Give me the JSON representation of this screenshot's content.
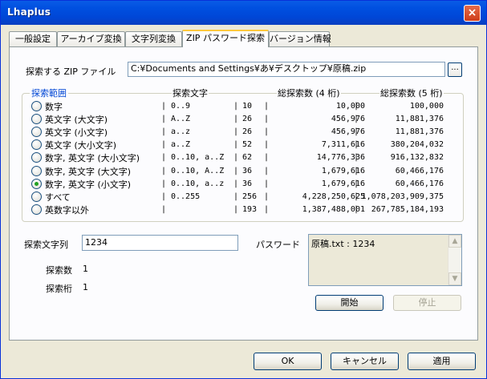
{
  "window": {
    "title": "Lhaplus",
    "close_icon": "×"
  },
  "tabs": [
    {
      "label": "一般設定"
    },
    {
      "label": "アーカイブ変換"
    },
    {
      "label": "文字列変換"
    },
    {
      "label": "ZIP パスワード探索"
    },
    {
      "label": "バージョン情報"
    }
  ],
  "target": {
    "label": "探索する ZIP ファイル",
    "value": "C:¥Documents and Settings¥あ¥デスクトップ¥原稿.zip",
    "browse_label": "..."
  },
  "range": {
    "legend": "探索範囲",
    "headers": {
      "chars": "探索文字",
      "total4": "総探索数 (4 桁)",
      "total5": "総探索数 (5 桁)"
    },
    "options": [
      {
        "label": "数字",
        "chars": "0..9",
        "count": "10",
        "total4": "10,000",
        "total5": "100,000",
        "selected": false
      },
      {
        "label": "英文字 (大文字)",
        "chars": "A..Z",
        "count": "26",
        "total4": "456,976",
        "total5": "11,881,376",
        "selected": false
      },
      {
        "label": "英文字 (小文字)",
        "chars": "a..z",
        "count": "26",
        "total4": "456,976",
        "total5": "11,881,376",
        "selected": false
      },
      {
        "label": "英文字 (大小文字)",
        "chars": "a..Z",
        "count": "52",
        "total4": "7,311,616",
        "total5": "380,204,032",
        "selected": false
      },
      {
        "label": "数字, 英文字 (大小文字)",
        "chars": "0..10, a..Z",
        "count": "62",
        "total4": "14,776,336",
        "total5": "916,132,832",
        "selected": false
      },
      {
        "label": "数字, 英文字 (大文字)",
        "chars": "0..10, A..Z",
        "count": "36",
        "total4": "1,679,616",
        "total5": "60,466,176",
        "selected": false
      },
      {
        "label": "数字, 英文字 (小文字)",
        "chars": "0..10, a..z",
        "count": "36",
        "total4": "1,679,616",
        "total5": "60,466,176",
        "selected": true
      },
      {
        "label": "すべて",
        "chars": "0..255",
        "count": "256",
        "total4": "4,228,250,625",
        "total5": "1,078,203,909,375",
        "selected": false
      },
      {
        "label": "英数字以外",
        "chars": "",
        "count": "193",
        "total4": "1,387,488,001",
        "total5": "267,785,184,193",
        "selected": false
      }
    ]
  },
  "search": {
    "string_label": "探索文字列",
    "string_value": "1234",
    "count_label": "探索数",
    "count_value": "1",
    "digits_label": "探索桁",
    "digits_value": "1"
  },
  "password": {
    "label": "パスワード",
    "value": "原稿.txt : 1234"
  },
  "actions": {
    "start": "開始",
    "stop": "停止"
  },
  "dialog": {
    "ok": "OK",
    "cancel": "キャンセル",
    "apply": "適用"
  },
  "separator": "|",
  "colors": {
    "title_bar": "#0054e3",
    "legend": "#0046d5",
    "radio_dot": "#21a121",
    "tab_active_accent": "#ffc83c"
  }
}
